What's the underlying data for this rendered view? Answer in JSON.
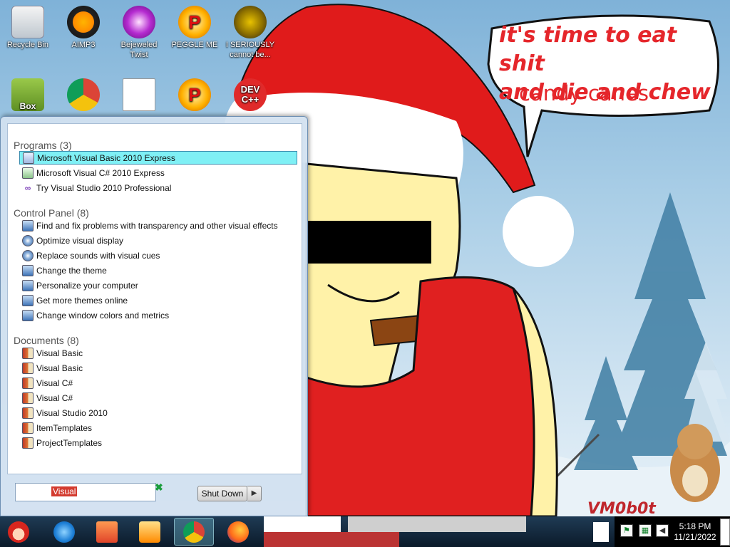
{
  "desktop": {
    "icons": [
      {
        "label": "Recycle Bin",
        "glyph": ""
      },
      {
        "label": "AIMP3",
        "glyph": ""
      },
      {
        "label": "Bejeweled Twist",
        "glyph": ""
      },
      {
        "label": "PEGGLE ME",
        "glyph": "P"
      },
      {
        "label": "I SERIOUSLY cannot be...",
        "glyph": ""
      },
      {
        "label": "",
        "glyph": "Box"
      },
      {
        "label": "",
        "glyph": ""
      },
      {
        "label": "",
        "glyph": ""
      },
      {
        "label": "",
        "glyph": "P"
      },
      {
        "label": "",
        "glyph": "DEV C++"
      }
    ],
    "icon_names": [
      "recycle-bin-icon",
      "aimp3-icon",
      "bejeweled-icon",
      "peggle-icon",
      "dark-app-icon",
      "box-app-icon",
      "chrome-icon",
      "calculator-icon",
      "peggle-alt-icon",
      "devcpp-icon"
    ]
  },
  "wallpaper": {
    "speech_line1": "it's time to eat shit",
    "speech_line2": "and die and chew",
    "speech_line3": "candy canes",
    "watermark": "VM0b0t"
  },
  "start_menu": {
    "groups": [
      {
        "title": "Programs (3)",
        "items": [
          {
            "label": "Microsoft Visual Basic 2010 Express",
            "icon": "vb-express-icon",
            "selected": true
          },
          {
            "label": "Microsoft Visual C# 2010 Express",
            "icon": "csharp-express-icon"
          },
          {
            "label": "Try Visual Studio 2010 Professional",
            "icon": "visual-studio-icon"
          }
        ]
      },
      {
        "title": "Control Panel (8)",
        "items": [
          {
            "label": "Find and fix problems with transparency and other visual effects",
            "icon": "troubleshoot-icon"
          },
          {
            "label": "Optimize visual display",
            "icon": "ease-of-access-icon"
          },
          {
            "label": "Replace sounds with visual cues",
            "icon": "ease-of-access-icon"
          },
          {
            "label": "Change the theme",
            "icon": "display-icon"
          },
          {
            "label": "Personalize your computer",
            "icon": "display-icon"
          },
          {
            "label": "Get more themes online",
            "icon": "display-icon"
          },
          {
            "label": "Change window colors and metrics",
            "icon": "display-icon"
          }
        ]
      },
      {
        "title": "Documents (8)",
        "items": [
          {
            "label": "Visual Basic",
            "icon": "folder-icon"
          },
          {
            "label": "Visual Basic",
            "icon": "folder-icon"
          },
          {
            "label": "Visual C#",
            "icon": "folder-icon"
          },
          {
            "label": "Visual C#",
            "icon": "folder-icon"
          },
          {
            "label": "Visual Studio 2010",
            "icon": "folder-icon"
          },
          {
            "label": "ItemTemplates",
            "icon": "folder-icon"
          },
          {
            "label": "ProjectTemplates",
            "icon": "folder-icon"
          }
        ]
      }
    ],
    "search_value": "Visual",
    "shutdown_label": "Shut Down"
  },
  "taskbar": {
    "start_icon": "santa-start-icon",
    "pinned": [
      "internet-explorer-icon",
      "file-explorer-icon",
      "media-player-icon",
      "chrome-icon",
      "firefox-icon"
    ],
    "tray_icons": [
      "action-center-flag-icon",
      "network-icon",
      "volume-icon"
    ],
    "time": "5:18 PM",
    "date": "11/21/2022"
  },
  "colors": {
    "speech_text": "#e5262b",
    "selection": "#7ff0f5",
    "search_highlight": "#d33b2f"
  }
}
